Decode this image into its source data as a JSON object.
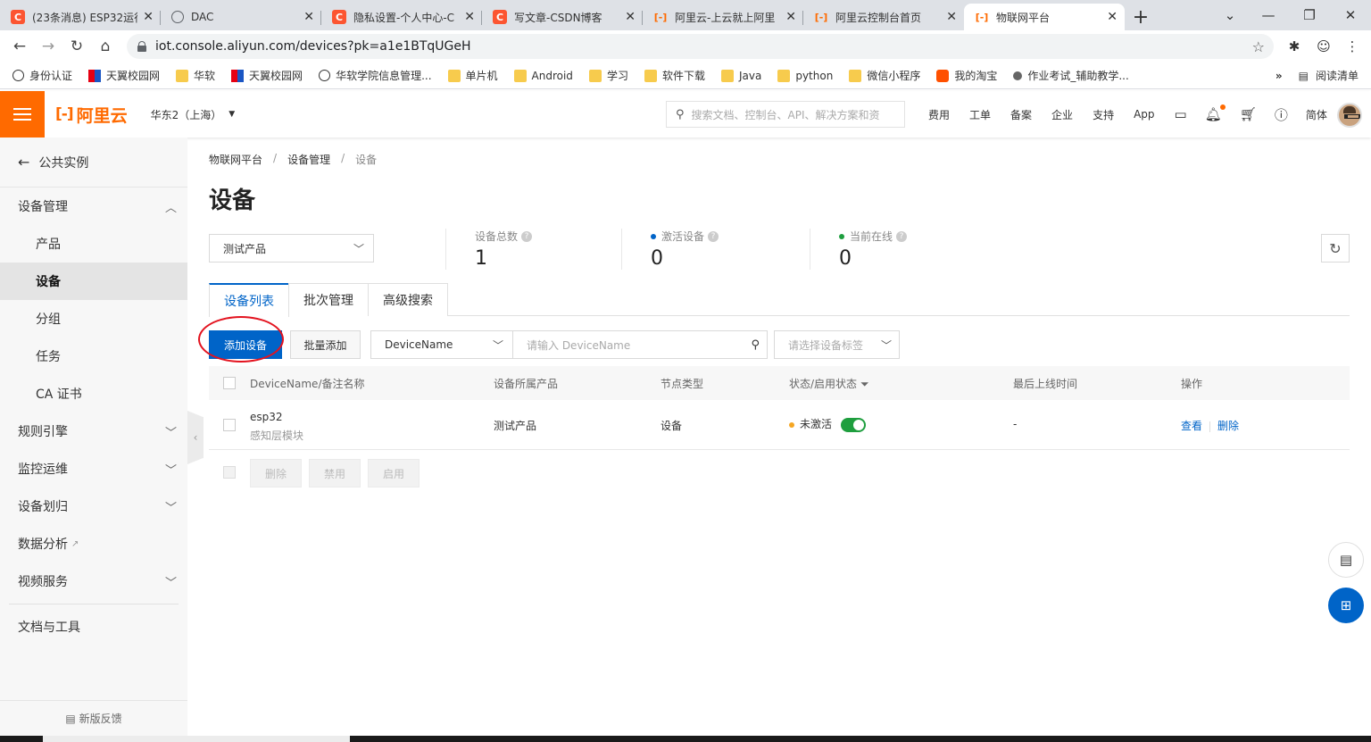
{
  "browser": {
    "tabs": [
      {
        "title": "(23条消息) ESP32运行",
        "icon": "csdn-icon"
      },
      {
        "title": "DAC",
        "icon": "globe-icon"
      },
      {
        "title": "隐私设置-个人中心-C",
        "icon": "csdn-icon"
      },
      {
        "title": "写文章-CSDN博客",
        "icon": "csdn-icon"
      },
      {
        "title": "阿里云-上云就上阿里",
        "icon": "aliyun-icon"
      },
      {
        "title": "阿里云控制台首页",
        "icon": "aliyun-icon"
      },
      {
        "title": "物联网平台",
        "icon": "aliyun-icon",
        "active": true
      }
    ],
    "url": "iot.console.aliyun.com/devices?pk=a1e1BTqUGeH",
    "bookmarks": [
      {
        "label": "身份认证",
        "icon": "globe"
      },
      {
        "label": "天翼校园网",
        "icon": "tianyi"
      },
      {
        "label": "华软",
        "icon": "folder"
      },
      {
        "label": "天翼校园网",
        "icon": "tianyi"
      },
      {
        "label": "华软学院信息管理...",
        "icon": "globe"
      },
      {
        "label": "单片机",
        "icon": "folder"
      },
      {
        "label": "Android",
        "icon": "folder"
      },
      {
        "label": "学习",
        "icon": "folder"
      },
      {
        "label": "软件下载",
        "icon": "folder"
      },
      {
        "label": "Java",
        "icon": "folder"
      },
      {
        "label": "python",
        "icon": "folder"
      },
      {
        "label": "微信小程序",
        "icon": "folder"
      },
      {
        "label": "我的淘宝",
        "icon": "taobao"
      },
      {
        "label": "作业考试_辅助教学...",
        "icon": "learn"
      }
    ],
    "bookmarks_more": "»",
    "reading_list": "阅读清单"
  },
  "console": {
    "logo_text": "阿里云",
    "region": "华东2（上海）",
    "search_placeholder": "搜索文档、控制台、API、解决方案和资",
    "nav": [
      "费用",
      "工单",
      "备案",
      "企业",
      "支持",
      "App"
    ],
    "lang": "简体"
  },
  "sidebar": {
    "back_label": "公共实例",
    "items": [
      {
        "label": "设备管理",
        "level": 0,
        "chevron": "up"
      },
      {
        "label": "产品",
        "level": 1
      },
      {
        "label": "设备",
        "level": 1,
        "active": true
      },
      {
        "label": "分组",
        "level": 1
      },
      {
        "label": "任务",
        "level": 1
      },
      {
        "label": "CA 证书",
        "level": 1
      },
      {
        "label": "规则引擎",
        "level": 0,
        "chevron": "down"
      },
      {
        "label": "监控运维",
        "level": 0,
        "chevron": "down"
      },
      {
        "label": "设备划归",
        "level": 0,
        "chevron": "down"
      },
      {
        "label": "数据分析",
        "level": 0,
        "external": true
      },
      {
        "label": "视频服务",
        "level": 0,
        "chevron": "down"
      }
    ],
    "docs_label": "文档与工具",
    "feedback_label": "新版反馈"
  },
  "main": {
    "breadcrumb": [
      "物联网平台",
      "设备管理",
      "设备"
    ],
    "title": "设备",
    "product_select": "测试产品",
    "stats": [
      {
        "label": "设备总数",
        "value": "1",
        "dot": ""
      },
      {
        "label": "激活设备",
        "value": "0",
        "dot": "#0064c8"
      },
      {
        "label": "当前在线",
        "value": "0",
        "dot": "#1e9e3e"
      }
    ],
    "tabs": [
      {
        "label": "设备列表",
        "active": true
      },
      {
        "label": "批次管理"
      },
      {
        "label": "高级搜索"
      }
    ],
    "toolbar": {
      "add_device": "添加设备",
      "batch_add": "批量添加",
      "field_select": "DeviceName",
      "search_placeholder": "请输入 DeviceName",
      "tag_placeholder": "请选择设备标签"
    },
    "table": {
      "headers": [
        "DeviceName/备注名称",
        "设备所属产品",
        "节点类型",
        "状态/启用状态",
        "最后上线时间",
        "操作"
      ],
      "rows": [
        {
          "name": "esp32",
          "remark": "感知层模块",
          "product": "测试产品",
          "node_type": "设备",
          "status": "未激活",
          "enabled": true,
          "last_online": "-",
          "actions": [
            "查看",
            "删除"
          ]
        }
      ]
    },
    "bulk_actions": [
      "删除",
      "禁用",
      "启用"
    ]
  },
  "colors": {
    "brand_orange": "#ff6a00",
    "primary_blue": "#0064c8",
    "status_inactive": "#f5a623",
    "toggle_on": "#1e9e3e",
    "annotation_red": "#e3131f"
  }
}
